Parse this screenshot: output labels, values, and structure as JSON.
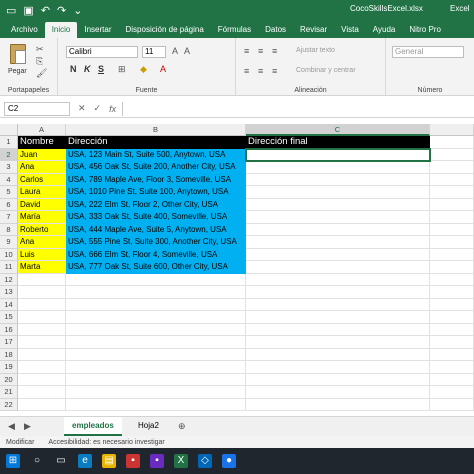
{
  "window": {
    "doc_title": "CocoSkillsExcel.xlsx",
    "app_name": "Excel"
  },
  "ribbon_tabs": [
    "Archivo",
    "Inicio",
    "Insertar",
    "Disposición de página",
    "Fórmulas",
    "Datos",
    "Revisar",
    "Vista",
    "Ayuda",
    "Nitro Pro"
  ],
  "ribbon": {
    "paste_label": "Pegar",
    "font_name": "Calibri",
    "font_size": "11",
    "bold": "N",
    "italic": "K",
    "underline": "S",
    "wrap_text": "Ajustar texto",
    "merge_center": "Combinar y centrar",
    "number_format": "General",
    "groups": [
      "Portapapeles",
      "Fuente",
      "Alineación",
      "Número"
    ]
  },
  "formula_bar": {
    "name_box": "C2",
    "fx": "fx",
    "value": ""
  },
  "columns": [
    "A",
    "B",
    "C"
  ],
  "rows": [
    "1",
    "2",
    "3",
    "4",
    "5",
    "6",
    "7",
    "8",
    "9",
    "10",
    "11",
    "12",
    "13",
    "14",
    "15",
    "16",
    "17",
    "18",
    "19",
    "20",
    "21",
    "22"
  ],
  "headers": [
    "Nombre",
    "Dirección",
    "Dirección final"
  ],
  "data": [
    {
      "nombre": "Juan",
      "direccion": "USA, 123 Main St, Suite 500, Anytown, USA"
    },
    {
      "nombre": "Ana",
      "direccion": "USA, 456 Oak St, Suite 200, Another City, USA"
    },
    {
      "nombre": "Carlos",
      "direccion": "USA, 789 Maple Ave, Floor 3, Someville, USA"
    },
    {
      "nombre": "Laura",
      "direccion": "USA, 1010 Pine St, Suite 100, Anytown, USA"
    },
    {
      "nombre": "David",
      "direccion": "USA, 222 Elm St, Floor 2, Other City, USA"
    },
    {
      "nombre": "María",
      "direccion": "USA, 333 Oak St, Suite 400, Someville, USA"
    },
    {
      "nombre": "Roberto",
      "direccion": "USA, 444 Maple Ave, Suite 5, Anytown, USA"
    },
    {
      "nombre": "Ana",
      "direccion": "USA, 555 Pine St, Suite 300, Another City, USA"
    },
    {
      "nombre": "Luis",
      "direccion": "USA, 666 Elm St, Floor 4, Someville, USA"
    },
    {
      "nombre": "Marta",
      "direccion": "USA, 777 Oak St, Suite 600, Other City, USA"
    }
  ],
  "sheets": [
    "empleados",
    "Hoja2"
  ],
  "active_sheet": "empleados",
  "status": {
    "mode": "Modificar",
    "accessibility": "Accesibilidad: es necesario investigar"
  },
  "colors": {
    "excel_green": "#217346",
    "highlight_yellow": "#ffff00",
    "highlight_cyan": "#00b0f0",
    "header_black": "#000000"
  }
}
